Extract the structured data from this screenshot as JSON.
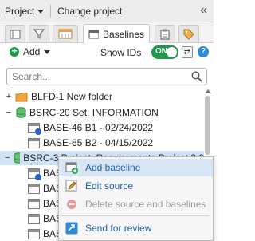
{
  "topbar": {
    "project_label": "Project",
    "change_project_label": "Change project",
    "collapse_glyph": "«"
  },
  "tabs": [
    {
      "name": "tab-notebook",
      "icon": "notebook-icon"
    },
    {
      "name": "tab-filter",
      "icon": "filter-icon"
    },
    {
      "name": "tab-calendar",
      "icon": "calendar-icon"
    },
    {
      "name": "tab-baselines",
      "icon": "window-icon",
      "label": "Baselines",
      "active": true
    },
    {
      "name": "tab-clipboard",
      "icon": "clipboard-icon"
    },
    {
      "name": "tab-tag",
      "icon": "tag-icon"
    }
  ],
  "toolbar": {
    "add_label": "Add",
    "show_ids_label": "Show IDs",
    "toggle_state": "ON",
    "refresh_glyph": "⇄",
    "help_glyph": "?"
  },
  "search": {
    "placeholder": "Search..."
  },
  "tree": {
    "rows": [
      {
        "label": "BLFD-1 New folder",
        "type": "folder",
        "expand": "+",
        "indent": 0
      },
      {
        "label": "BSRC-20 Set: INFORMATION",
        "type": "source",
        "expand": "−",
        "indent": 0
      },
      {
        "label": "BASE-46 B1 - 02/24/2022",
        "type": "baseline",
        "indent": 1
      },
      {
        "label": "BASE-65 B2 - 04/15/2022",
        "type": "baseline",
        "indent": 1
      },
      {
        "label": "BSRC-3 Project: Requirements Project 2.0",
        "type": "source",
        "expand": "−",
        "indent": 0,
        "selected": true
      },
      {
        "label": "BASE-",
        "type": "baseline",
        "indent": 1
      },
      {
        "label": "BAS",
        "type": "baseline",
        "indent": 1
      },
      {
        "label": "BAS",
        "type": "baseline",
        "indent": 1
      },
      {
        "label": "BAS",
        "type": "baseline",
        "indent": 1
      },
      {
        "label": "BAS",
        "type": "baseline",
        "indent": 1
      }
    ]
  },
  "context_menu": {
    "items": [
      {
        "label": "Add baseline",
        "icon": "add-baseline-icon",
        "highlight": true
      },
      {
        "label": "Edit source",
        "icon": "pencil-icon"
      },
      {
        "label": "Delete source and baselines",
        "icon": "minus-circle-icon",
        "disabled": true
      },
      {
        "label": "Send for review",
        "icon": "send-icon"
      }
    ]
  },
  "colors": {
    "accent_green": "#1c9a4a",
    "link_blue": "#1f5fa8",
    "selected_row": "#cfe3f7",
    "menu_highlight": "#d7e6f5",
    "help_blue": "#2d8ad8"
  }
}
